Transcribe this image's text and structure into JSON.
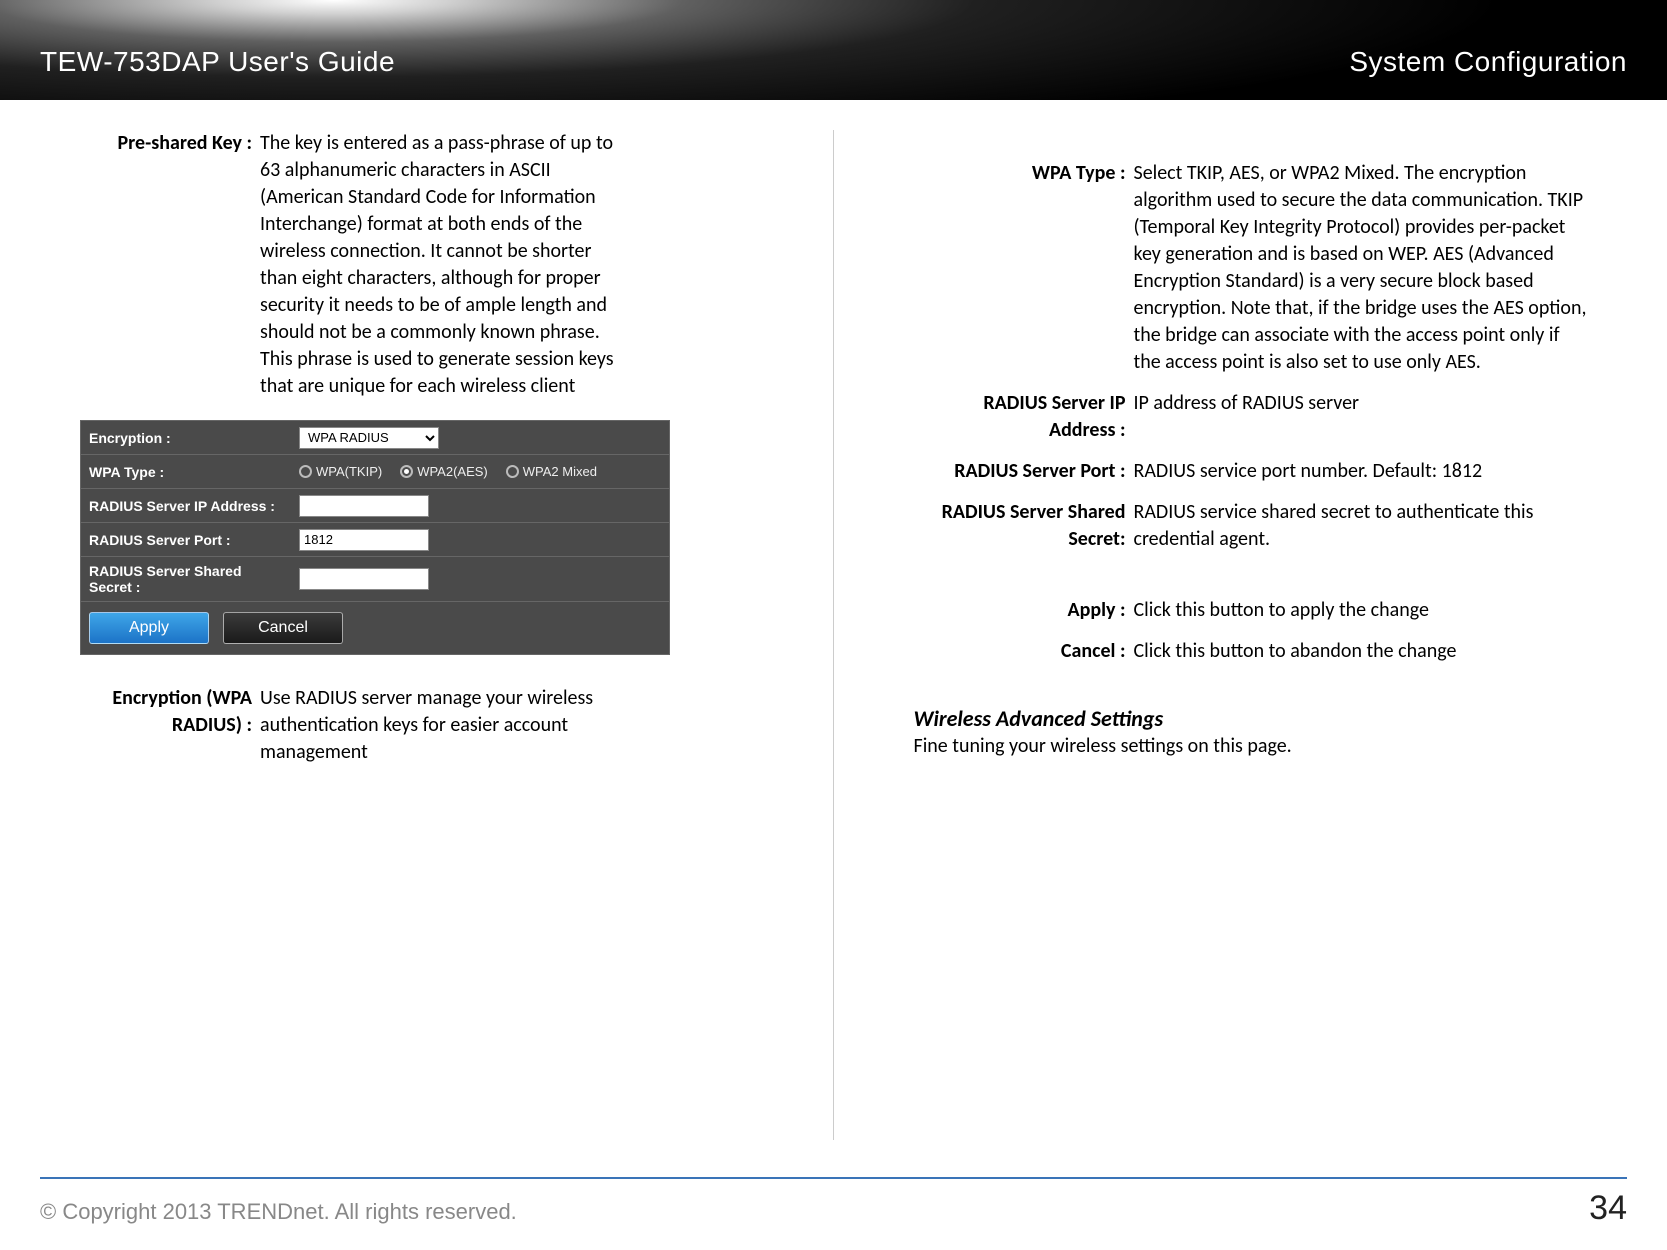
{
  "header": {
    "left": "TEW-753DAP User's Guide",
    "right": "System Configuration"
  },
  "left_col": {
    "presharedkey": {
      "label": "Pre-shared Key :",
      "text": "The key is entered as a pass-phrase of up to 63 alphanumeric characters in ASCII (American Standard Code for Information Interchange) format at both ends of the wireless connection. It cannot be shorter than eight characters, although for proper security it needs to be of ample length and should not be a commonly known phrase. This phrase is used to generate session keys that are unique for each wireless client"
    },
    "encryption_radius": {
      "label": "Encryption (WPA RADIUS) :",
      "text": "Use RADIUS server manage your wireless authentication keys for easier account management"
    },
    "panel": {
      "encryption_label": "Encryption :",
      "encryption_value": "WPA RADIUS",
      "wpatype_label": "WPA Type :",
      "wpa_opts": [
        "WPA(TKIP)",
        "WPA2(AES)",
        "WPA2 Mixed"
      ],
      "ip_label": "RADIUS Server IP Address :",
      "port_label": "RADIUS Server Port :",
      "port_value": "1812",
      "secret_label": "RADIUS Server Shared Secret :",
      "apply": "Apply",
      "cancel": "Cancel"
    }
  },
  "right_col": {
    "wpatype": {
      "label": "WPA Type :",
      "text": "Select TKIP, AES, or WPA2 Mixed. The encryption algorithm used to secure the data communication. TKIP (Temporal Key Integrity Protocol) provides per-packet key generation and is based on WEP. AES (Advanced Encryption Standard) is a very secure block based encryption. Note that, if the bridge uses the AES option, the bridge can associate with the access point only if the access point is also set to use only AES."
    },
    "radius_ip": {
      "label": "RADIUS Server IP Address :",
      "text": "IP address of RADIUS server"
    },
    "radius_port": {
      "label": "RADIUS Server Port :",
      "text": "RADIUS service port number. Default: 1812"
    },
    "radius_secret": {
      "label": "RADIUS Server Shared Secret:",
      "text": "RADIUS service shared secret to authenticate this credential agent."
    },
    "apply_desc": {
      "label": "Apply :",
      "text": "Click this button to apply the change"
    },
    "cancel_desc": {
      "label": "Cancel :",
      "text": "Click this button to abandon the change"
    },
    "adv_title": "Wireless Advanced Settings",
    "adv_sub": "Fine tuning your wireless settings on this page."
  },
  "footer": {
    "copyright": "© Copyright 2013 TRENDnet. All rights reserved.",
    "page": "34"
  }
}
